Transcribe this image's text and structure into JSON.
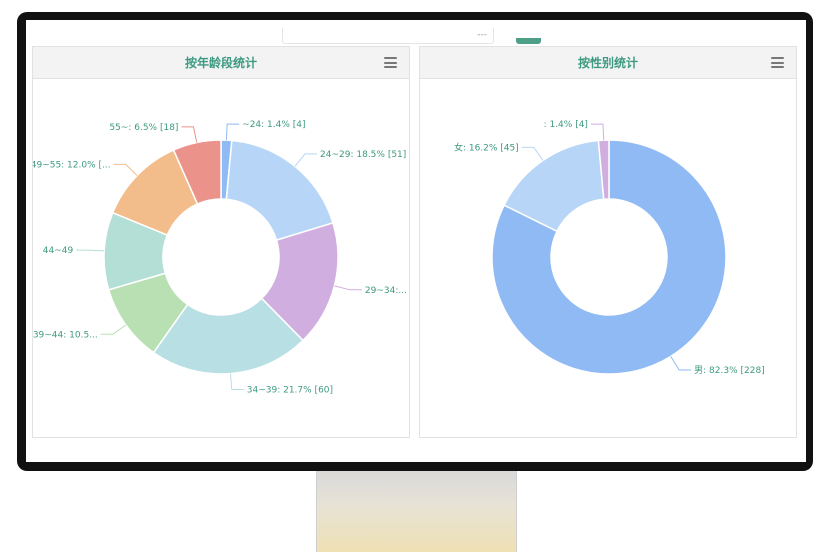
{
  "top_bar": {
    "input_text": "---"
  },
  "colors": {
    "title": "#3d9a80",
    "header_bg": "#f3f3f3",
    "accent": "#4e9f87"
  },
  "chart_data": [
    {
      "type": "pie",
      "title": "按年龄段统计",
      "donut": true,
      "slices": [
        {
          "label": "~24: 1.4% [4]",
          "value": 4,
          "color": "#8fbaf4"
        },
        {
          "label": "24~29: 18.5% [51]",
          "value": 51,
          "color": "#b7d6f7"
        },
        {
          "label": "29~34:...",
          "value": 47,
          "color": "#d1aee0"
        },
        {
          "label": "34~39: 21.7% [60]",
          "value": 60,
          "color": "#b8dfe3"
        },
        {
          "label": "39~44: 10.5...",
          "value": 29,
          "color": "#b8e0b3"
        },
        {
          "label": "44~49",
          "value": 29,
          "color": "#b4dfd6"
        },
        {
          "label": "49~55: 12.0% [...",
          "value": 33,
          "color": "#f2bc8b"
        },
        {
          "label": "55~: 6.5% [18]",
          "value": 18,
          "color": "#eb928a"
        }
      ]
    },
    {
      "type": "pie",
      "title": "按性别统计",
      "donut": true,
      "slices": [
        {
          "label": "男: 82.3% [228]",
          "value": 228,
          "color": "#8fbaf4"
        },
        {
          "label": "女: 16.2% [45]",
          "value": 45,
          "color": "#b7d6f7"
        },
        {
          "label": ": 1.4% [4]",
          "value": 4,
          "color": "#d1aee0"
        }
      ]
    }
  ]
}
